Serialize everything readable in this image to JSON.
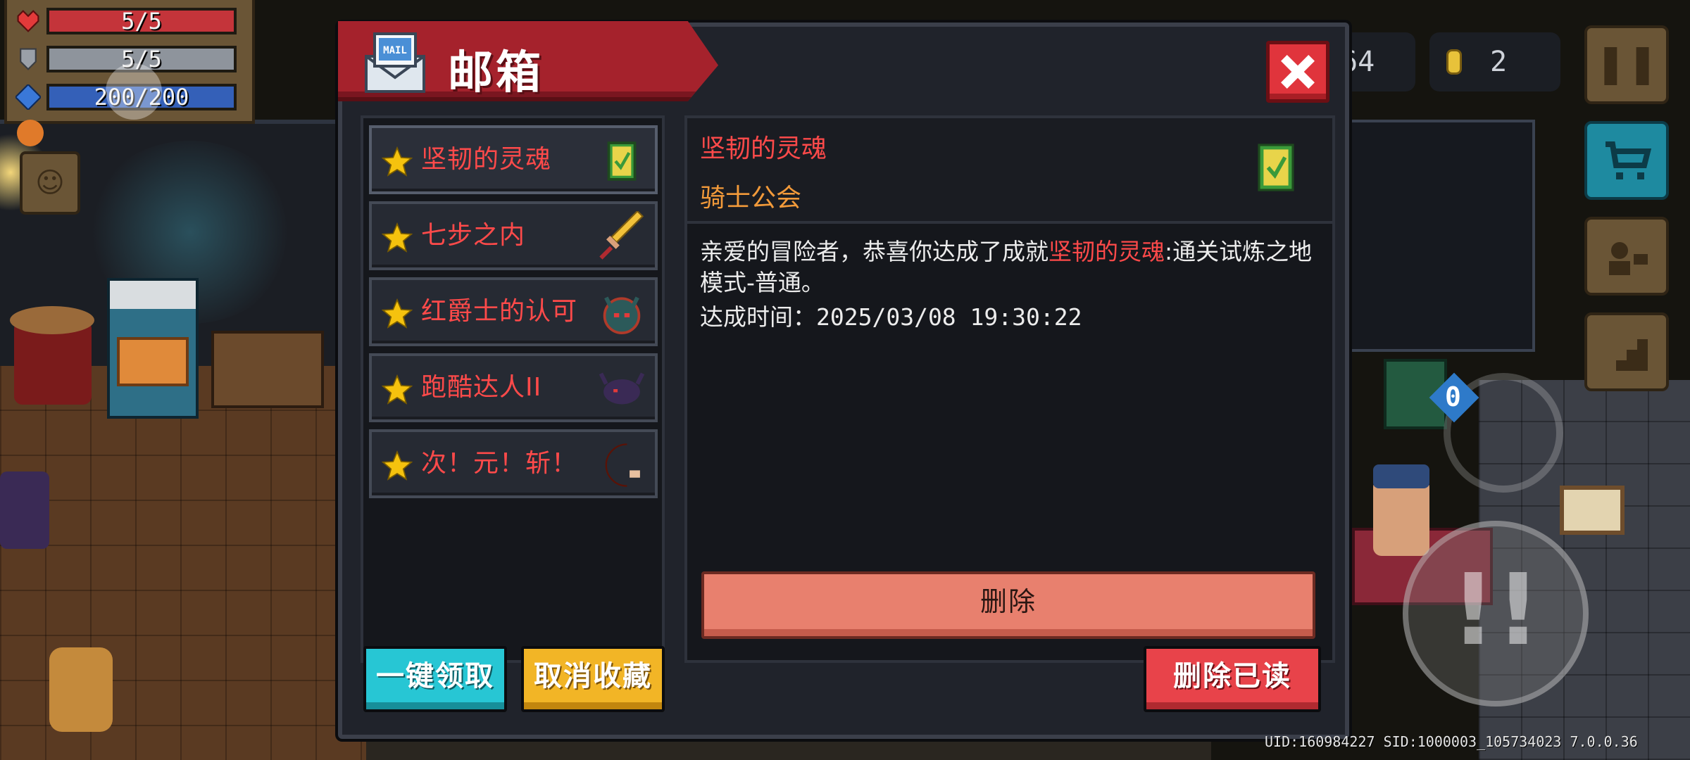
{
  "hud": {
    "health": "5/5",
    "armor": "5/5",
    "energy": "200/200",
    "gems_partial": "64",
    "coins": "2"
  },
  "mailbox": {
    "title": "邮箱",
    "mail_icon_text": "MAIL",
    "items": [
      {
        "label": "坚韧的灵魂",
        "icon": "achievement-book-icon"
      },
      {
        "label": "七步之内",
        "icon": "golden-sword-icon"
      },
      {
        "label": "红爵士的认可",
        "icon": "horned-helmet-icon"
      },
      {
        "label": "跑酷达人II",
        "icon": "shadow-creature-icon"
      },
      {
        "label": "次！元！斩！",
        "icon": "crescent-blade-icon"
      }
    ],
    "detail": {
      "title": "坚韧的灵魂",
      "sender": "骑士公会",
      "body_prefix": "亲爱的冒险者，恭喜你达成了成就",
      "body_highlight": "坚韧的灵魂",
      "body_suffix": ":通关试炼之地模式-普通。",
      "time": "达成时间：2025/03/08 19:30:22",
      "delete_label": "删除"
    },
    "buttons": {
      "claim_all": "一键领取",
      "unfavorite": "取消收藏",
      "delete_read": "删除已读"
    }
  },
  "footer": "UID:160984227 SID:1000003_105734023 7.0.0.36",
  "colors": {
    "accent_red": "#a5222c",
    "highlight_text": "#ff4a4a",
    "sender_text": "#f29a3a"
  }
}
